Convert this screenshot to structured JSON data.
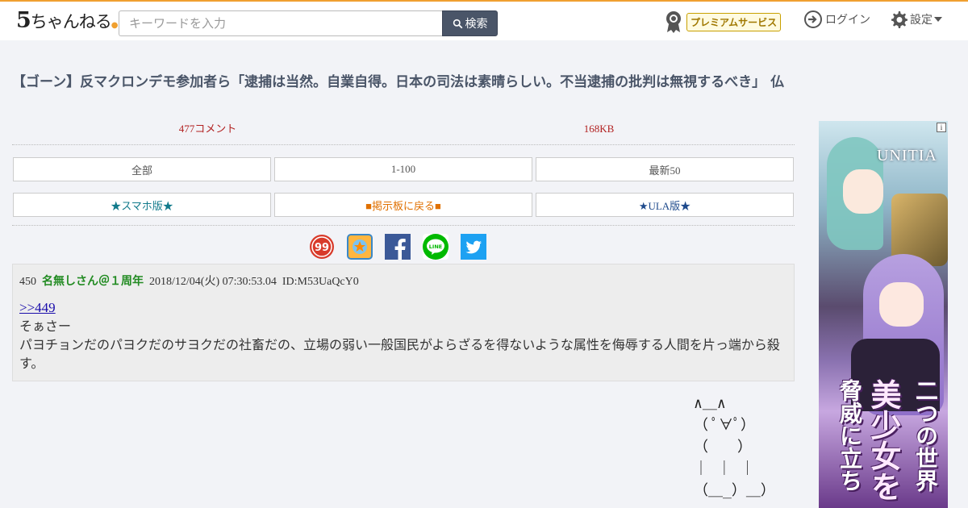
{
  "header": {
    "logo_main": "5",
    "logo_rest": "ちゃんねる",
    "logo_dot": "●",
    "search_placeholder": "キーワードを入力",
    "search_button": "検索",
    "premium": "プレミアムサービス",
    "login": "ログイン",
    "settings": "設定"
  },
  "thread": {
    "title": "【ゴーン】反マクロンデモ参加者ら「逮捕は当然。自業自得。日本の司法は素晴らしい。不当逮捕の批判は無視するべき」 仏",
    "comments": "477コメント",
    "size": "168KB"
  },
  "nav": {
    "row1": [
      "全部",
      "1-100",
      "最新50"
    ],
    "row2": [
      "★スマホ版★",
      "■掲示板に戻る■",
      "★ULA版★"
    ]
  },
  "share_icons": [
    "2ch-icon",
    "bookmark-icon",
    "facebook-icon",
    "line-icon",
    "twitter-icon"
  ],
  "post": {
    "number": "450",
    "name": "名無しさん＠１周年",
    "date": "2018/12/04(火) 07:30:53.04",
    "id": "ID:M53UaQcY0",
    "anchor": ">>449",
    "line1": "そぁさー",
    "line2": "パヨチョンだのパヨクだのサヨクだの社畜だの、立場の弱い一般国民がよらざるを得ないような属性を侮辱する人間を片っ端から殺す。"
  },
  "ascii_art": "∧＿∧\n（ ﾟ∀ﾟ）\n（　　）\n｜ ｜ ｜\n（＿_）＿）",
  "ad": {
    "info": "i",
    "brand": "UNITIA",
    "copy1": "二つの世界",
    "copy2": "美少女を",
    "copy3": "脅威に立ち"
  }
}
